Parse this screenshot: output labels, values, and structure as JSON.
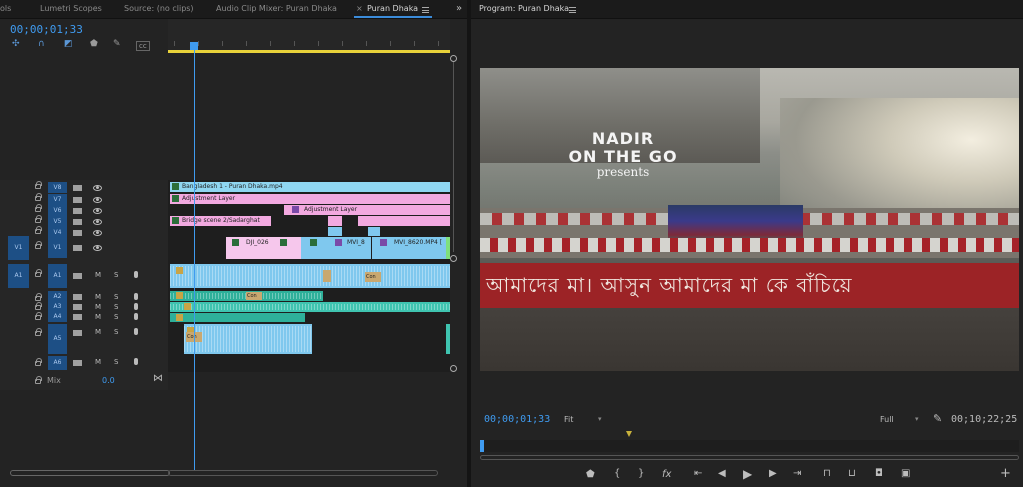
{
  "tabs_left": [
    {
      "label": "ols",
      "active": false
    },
    {
      "label": "Lumetri Scopes",
      "active": false
    },
    {
      "label": "Source: (no clips)",
      "active": false
    },
    {
      "label": "Audio Clip Mixer: Puran Dhaka",
      "active": false
    },
    {
      "label": "Puran Dhaka",
      "active": true
    }
  ],
  "tab_close": "×",
  "tab_overflow": "»",
  "program_tab": {
    "label": "Program: Puran Dhaka"
  },
  "timeline": {
    "timecode": "00;00;01;33",
    "tools": [
      "snap-icon",
      "linked-selection-icon",
      "add-marker-icon",
      "wrench-icon",
      "captions-icon"
    ],
    "mix_label": "Mix",
    "mix_value": "0.0",
    "video_tracks": [
      "V8",
      "V7",
      "V6",
      "V5",
      "V4",
      "V3",
      "V2",
      "V1"
    ],
    "audio_tracks": [
      "A1",
      "A2",
      "A3",
      "A4",
      "A5",
      "A6"
    ],
    "source_patch_video": "V1",
    "source_patch_audio": "A1",
    "mute_label": "M",
    "solo_label": "S",
    "clips": {
      "bangladesh": "Bangladesh 1 - Puran Dhaka.mp4",
      "adjustment_1": "Adjustment Layer",
      "adjustment_2": "Adjustment Layer",
      "bridge": "Bridge scene 2/Sadarghat",
      "dji": "DJI_026",
      "mvi_8": "MVI_8",
      "mvi_8620": "MVI_8620.MP4 [",
      "con_1": "Con",
      "con_2": "Con",
      "con_3": "Con"
    }
  },
  "program": {
    "title_line1": "NADIR",
    "title_line2": "ON THE GO",
    "title_line3": "presents",
    "banner_text": "আমাদের মা। আসুন আমাদের মা কে বাঁচিয়ে",
    "timecode_current": "00;00;01;33",
    "fit_label": "Fit",
    "resolution_label": "Full",
    "timecode_duration": "00;10;22;25",
    "controls": [
      "add-marker-icon",
      "mark-in-icon",
      "mark-out-icon",
      "fx-icon",
      "go-to-in-icon",
      "step-back-icon",
      "play-icon",
      "step-forward-icon",
      "go-to-out-icon",
      "lift-icon",
      "extract-icon",
      "export-frame-icon",
      "comparison-icon",
      "add-icon"
    ],
    "fx_glyph": "fx",
    "mark_in_glyph": "{",
    "mark_out_glyph": "}",
    "add_glyph": "+"
  }
}
